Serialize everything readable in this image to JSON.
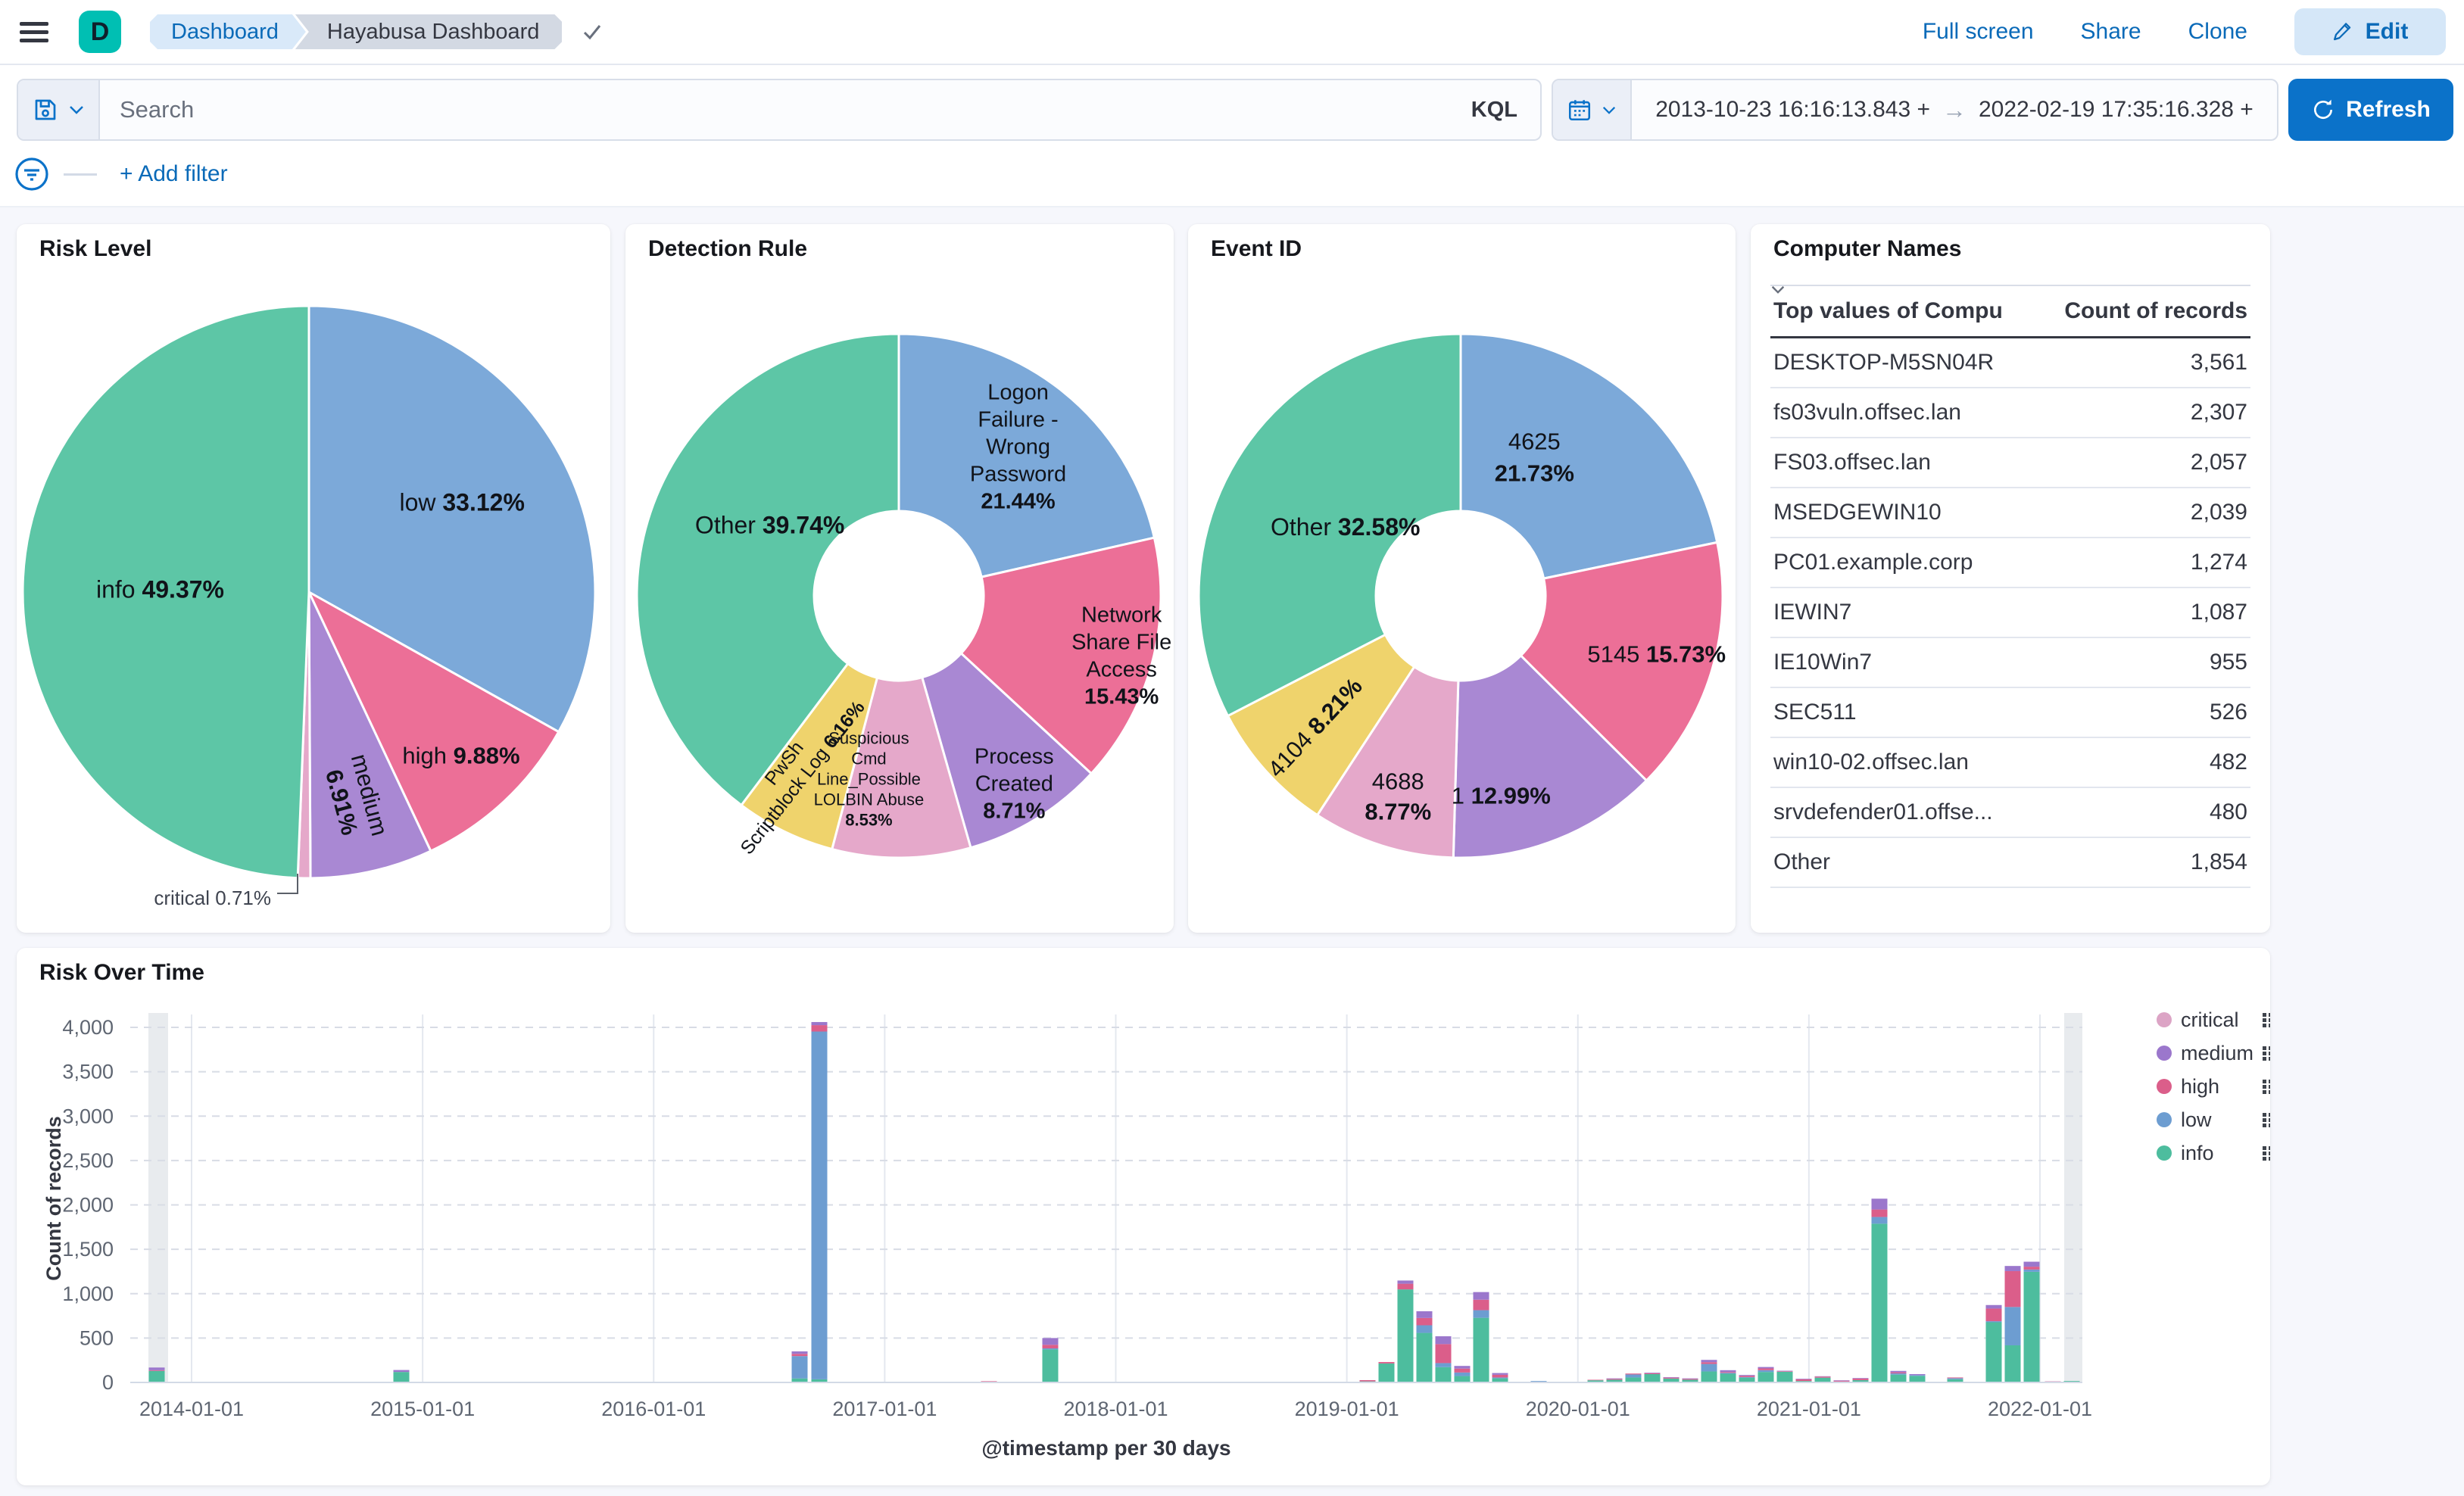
{
  "nav": {
    "logo_letter": "D",
    "breadcrumbs": [
      "Dashboard",
      "Hayabusa Dashboard"
    ],
    "actions": {
      "full_screen": "Full screen",
      "share": "Share",
      "clone": "Clone",
      "edit": "Edit"
    }
  },
  "query": {
    "placeholder": "Search",
    "language": "KQL",
    "date_from": "2013-10-23 16:16:13.843 +",
    "date_to": "2022-02-19 17:35:16.328 +",
    "arrow": "→",
    "refresh": "Refresh",
    "add_filter": "+ Add filter"
  },
  "colors": {
    "accent_blue": "#0B72C9",
    "link_blue": "#0A6AB8",
    "teal_logo": "#00BFB3",
    "series": {
      "critical": "#DCA4C5",
      "medium": "#9B77CC",
      "high": "#DB5E8A",
      "low": "#6D9DD1",
      "info": "#4DBD9E"
    }
  },
  "chart_data": [
    {
      "id": "risk_level",
      "type": "pie",
      "title": "Risk Level",
      "slices": [
        {
          "name": "low",
          "value": 33.12,
          "pct_label": "33.12%",
          "color": "#7CA9D9",
          "label": {
            "lines": [
              "low"
            ],
            "inline": true,
            "r": 0.62,
            "size": 32
          }
        },
        {
          "name": "high",
          "value": 9.88,
          "pct_label": "9.88%",
          "color": "#EC6F97",
          "label": {
            "lines": [
              "high"
            ],
            "inline": true,
            "r": 0.78,
            "size": 31
          }
        },
        {
          "name": "medium",
          "value": 6.91,
          "pct_label": "6.91%",
          "color": "#A988D3",
          "label": {
            "lines": [
              "medium"
            ],
            "inline": false,
            "r": 0.74,
            "size": 31,
            "lh": 38,
            "rotate": 75
          }
        },
        {
          "name": "critical",
          "value": 0.71,
          "pct_label": "0.71%",
          "color": "#E5A8CA",
          "label": {
            "lines": [
              "critical"
            ],
            "inline": true,
            "muted": true,
            "size": 26,
            "pos": [
              336,
              890
            ],
            "anchor": "end"
          }
        },
        {
          "name": "info",
          "value": 49.37,
          "pct_label": "49.37%",
          "color": "#5DC6A6",
          "label": {
            "lines": [
              "info"
            ],
            "inline": true,
            "r": 0.52,
            "size": 32
          }
        }
      ],
      "callout": [
        [
          371,
          858
        ],
        [
          371,
          884
        ],
        [
          344,
          884
        ]
      ]
    },
    {
      "id": "detection_rule",
      "type": "donut",
      "title": "Detection Rule",
      "slices": [
        {
          "name": "Logon Failure - Wrong Password",
          "value": 21.44,
          "pct_label": "21.44%",
          "color": "#7CA9D9",
          "label": {
            "lines": [
              "Logon",
              "Failure -",
              "Wrong",
              "Password"
            ],
            "inline": false,
            "r": 0.73,
            "size": 29,
            "lh": 36
          }
        },
        {
          "name": "Network Share File Access",
          "value": 15.43,
          "pct_label": "15.43%",
          "color": "#EC6F97",
          "label": {
            "lines": [
              "Network",
              "Share File",
              "Access"
            ],
            "inline": false,
            "r": 0.88,
            "size": 29,
            "lh": 36
          }
        },
        {
          "name": "Process Created",
          "value": 8.71,
          "pct_label": "8.71%",
          "color": "#A988D3",
          "label": {
            "lines": [
              "Process",
              "Created"
            ],
            "inline": false,
            "r": 0.84,
            "size": 29,
            "lh": 36
          }
        },
        {
          "name": "Suspicious Cmd Line_Possible LOLBIN Abuse",
          "value": 8.53,
          "pct_label": "8.53%",
          "color": "#E5A8CA",
          "label": {
            "lines": [
              "Suspicious",
              "Cmd",
              "Line_Possible",
              "LOLBIN Abuse"
            ],
            "inline": false,
            "r": 0.7,
            "size": 22,
            "lh": 27,
            "dx": -42
          }
        },
        {
          "name": "PwSh Scriptblock Log",
          "value": 6.16,
          "pct_label": "6.16%",
          "color": "#EFD36C",
          "label": {
            "lines": [
              "PwSh",
              "Scriptblock Log"
            ],
            "inline": true,
            "r": 0.74,
            "size": 25,
            "lh": 31,
            "rotate": -52,
            "dx": -28
          }
        },
        {
          "name": "Other",
          "value": 39.74,
          "pct_label": "39.74%",
          "color": "#5DC6A6",
          "label": {
            "lines": [
              "Other"
            ],
            "inline": true,
            "r": 0.58,
            "size": 32,
            "dx": 20,
            "dy": -30
          }
        }
      ]
    },
    {
      "id": "event_id",
      "type": "donut",
      "title": "Event ID",
      "slices": [
        {
          "name": "4625",
          "value": 21.73,
          "pct_label": "21.73%",
          "color": "#7CA9D9",
          "label": {
            "lines": [
              "4625"
            ],
            "inline": false,
            "r": 0.62,
            "size": 31,
            "lh": 42,
            "dx": -38,
            "dy": -18
          }
        },
        {
          "name": "5145",
          "value": 15.73,
          "pct_label": "15.73%",
          "color": "#EC6F97",
          "label": {
            "lines": [
              "5145"
            ],
            "inline": true,
            "r": 0.78,
            "size": 31
          }
        },
        {
          "name": "1",
          "value": 12.99,
          "pct_label": "12.99%",
          "color": "#A988D3",
          "label": {
            "lines": [
              "1"
            ],
            "inline": true,
            "r": 0.82,
            "size": 31,
            "dx": -52
          }
        },
        {
          "name": "4688",
          "value": 8.77,
          "pct_label": "8.77%",
          "color": "#E5A8CA",
          "label": {
            "lines": [
              "4688"
            ],
            "inline": false,
            "r": 0.8,
            "size": 31,
            "lh": 40
          }
        },
        {
          "name": "4104",
          "value": 8.21,
          "pct_label": "8.21%",
          "color": "#EFD36C",
          "label": {
            "lines": [
              "4104"
            ],
            "inline": true,
            "r": 0.75,
            "size": 31,
            "rotate": -47
          }
        },
        {
          "name": "Other",
          "value": 32.58,
          "pct_label": "32.58%",
          "color": "#5DC6A6",
          "label": {
            "lines": [
              "Other"
            ],
            "inline": true,
            "r": 0.6,
            "size": 32,
            "dx": 25,
            "dy": 17
          }
        }
      ]
    },
    {
      "id": "computer_names",
      "type": "table",
      "title": "Computer Names",
      "columns": [
        "Top values of Compu",
        "Count of records"
      ],
      "rows": [
        [
          "DESKTOP-M5SN04R",
          "3,561"
        ],
        [
          "fs03vuln.offsec.lan",
          "2,307"
        ],
        [
          "FS03.offsec.lan",
          "2,057"
        ],
        [
          "MSEDGEWIN10",
          "2,039"
        ],
        [
          "PC01.example.corp",
          "1,274"
        ],
        [
          "IEWIN7",
          "1,087"
        ],
        [
          "IE10Win7",
          "955"
        ],
        [
          "SEC511",
          "526"
        ],
        [
          "win10-02.offsec.lan",
          "482"
        ],
        [
          "srvdefender01.offse...",
          "480"
        ],
        [
          "Other",
          "1,854"
        ]
      ]
    },
    {
      "id": "risk_over_time",
      "type": "bar",
      "title": "Risk Over Time",
      "xlabel": "@timestamp per 30 days",
      "ylabel": "Count of records",
      "ylim": [
        0,
        4000
      ],
      "ytick_labels": [
        "0",
        "500",
        "1,000",
        "1,500",
        "2,000",
        "2,500",
        "3,000",
        "3,500",
        "4,000"
      ],
      "xticks": [
        "2014-01-01",
        "2015-01-01",
        "2016-01-01",
        "2017-01-01",
        "2018-01-01",
        "2019-01-01",
        "2020-01-01",
        "2021-01-01",
        "2022-01-01"
      ],
      "legend": [
        "critical",
        "medium",
        "high",
        "low",
        "info"
      ],
      "stack_order": [
        "info",
        "low",
        "high",
        "medium",
        "critical"
      ],
      "bars": [
        {
          "x": 207,
          "info": 130,
          "high": 8,
          "medium": 30
        },
        {
          "x": 530,
          "info": 118,
          "medium": 22
        },
        {
          "x": 1056,
          "info": 45,
          "low": 252,
          "high": 25,
          "medium": 28
        },
        {
          "x": 1082,
          "info": 35,
          "low": 3918,
          "high": 72,
          "medium": 35
        },
        {
          "x": 1306,
          "high": 14
        },
        {
          "x": 1387,
          "info": 372,
          "low": 12,
          "high": 40,
          "medium": 76
        },
        {
          "x": 1806,
          "info": 12,
          "high": 14
        },
        {
          "x": 1831,
          "info": 214,
          "high": 16
        },
        {
          "x": 1856,
          "info": 1048,
          "high": 64,
          "medium": 36
        },
        {
          "x": 1881,
          "info": 558,
          "low": 86,
          "high": 82,
          "medium": 76
        },
        {
          "x": 1906,
          "info": 172,
          "low": 46,
          "high": 214,
          "medium": 88
        },
        {
          "x": 1931,
          "info": 72,
          "low": 40,
          "high": 44,
          "medium": 30
        },
        {
          "x": 1956,
          "info": 728,
          "low": 86,
          "high": 118,
          "medium": 86
        },
        {
          "x": 1981,
          "info": 46,
          "low": 10,
          "high": 30,
          "medium": 20
        },
        {
          "x": 2032,
          "low": 16
        },
        {
          "x": 2107,
          "info": 24,
          "high": 6
        },
        {
          "x": 2132,
          "info": 30,
          "high": 10,
          "medium": 6
        },
        {
          "x": 2157,
          "info": 56,
          "low": 34,
          "high": 10
        },
        {
          "x": 2182,
          "info": 94,
          "high": 10,
          "medium": 6
        },
        {
          "x": 2207,
          "info": 44,
          "high": 10,
          "medium": 6
        },
        {
          "x": 2232,
          "info": 30,
          "high": 10,
          "medium": 6
        },
        {
          "x": 2257,
          "info": 124,
          "low": 84,
          "high": 20,
          "medium": 26
        },
        {
          "x": 2282,
          "info": 98,
          "low": 10,
          "high": 10,
          "medium": 20
        },
        {
          "x": 2307,
          "info": 54,
          "low": 6,
          "high": 14,
          "medium": 10
        },
        {
          "x": 2332,
          "info": 118,
          "low": 20,
          "high": 20,
          "medium": 16
        },
        {
          "x": 2357,
          "info": 120,
          "high": 6,
          "medium": 6
        },
        {
          "x": 2382,
          "info": 16,
          "high": 20,
          "medium": 6
        },
        {
          "x": 2407,
          "info": 54,
          "high": 12,
          "medium": 4
        },
        {
          "x": 2432,
          "info": 6,
          "high": 10,
          "medium": 6,
          "critical": 4
        },
        {
          "x": 2457,
          "info": 26,
          "high": 18,
          "medium": 6
        },
        {
          "x": 2482,
          "info": 1788,
          "low": 76,
          "high": 84,
          "medium": 122
        },
        {
          "x": 2507,
          "info": 88,
          "low": 14,
          "high": 12,
          "medium": 16
        },
        {
          "x": 2532,
          "info": 74,
          "low": 8,
          "medium": 12
        },
        {
          "x": 2582,
          "info": 36,
          "low": 12,
          "high": 8
        },
        {
          "x": 2633,
          "info": 678,
          "low": 12,
          "high": 142,
          "medium": 40
        },
        {
          "x": 2658,
          "info": 418,
          "low": 432,
          "high": 404,
          "medium": 58
        },
        {
          "x": 2683,
          "info": 1246,
          "low": 26,
          "high": 32,
          "medium": 56
        },
        {
          "x": 2711,
          "critical": 14
        },
        {
          "x": 2736,
          "info": 16
        }
      ],
      "bands": [
        {
          "x": 196,
          "w": 26
        },
        {
          "x": 2726,
          "w": 24
        }
      ]
    }
  ]
}
